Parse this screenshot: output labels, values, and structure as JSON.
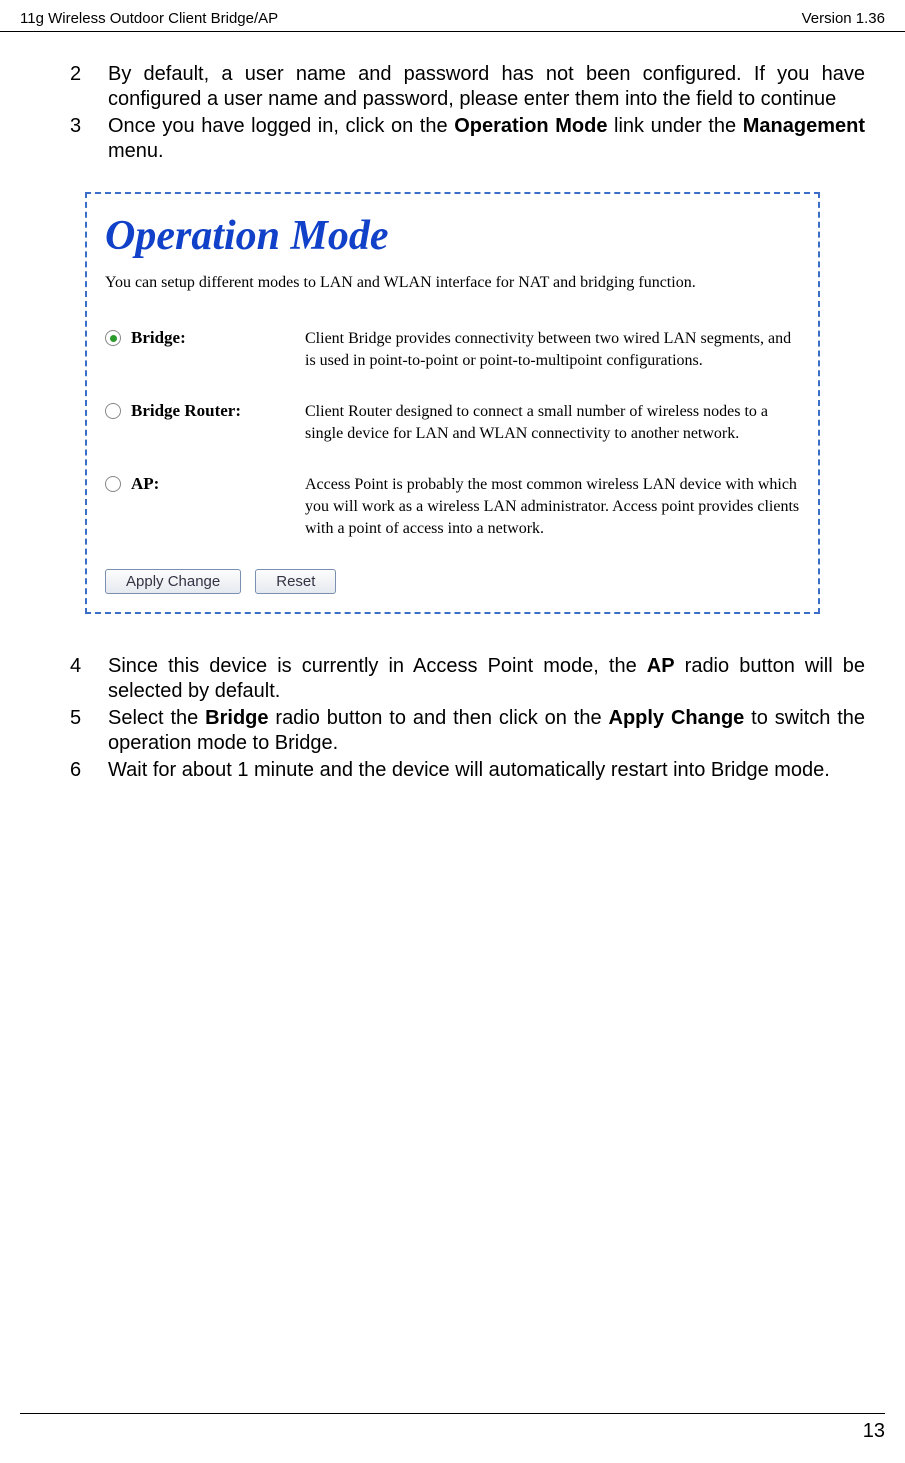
{
  "header": {
    "left": "11g Wireless Outdoor Client Bridge/AP",
    "right": "Version 1.36"
  },
  "steps_top": [
    {
      "num": "2",
      "html": "By default, a user name and password has not been configured. If you have configured a user name and password, please enter them into the field to continue"
    },
    {
      "num": "3",
      "html": "Once you have logged in, click on the <b>Operation Mode</b> link under the <b>Management</b> menu."
    }
  ],
  "panel": {
    "title": "Operation Mode",
    "desc": "You can setup different modes to LAN and WLAN interface for NAT and bridging function.",
    "modes": [
      {
        "selected": true,
        "label": "Bridge:",
        "text": "Client Bridge provides connectivity between two wired LAN segments, and is used in point-to-point or point-to-multipoint configurations."
      },
      {
        "selected": false,
        "label": "Bridge Router:",
        "text": "Client Router designed to connect a small number of wireless nodes to a single device for LAN and WLAN connectivity to another network."
      },
      {
        "selected": false,
        "label": "AP:",
        "text": "Access Point is probably the most common wireless LAN device with which you will work as a wireless LAN administrator. Access point provides clients with a point of access into a network."
      }
    ],
    "buttons": {
      "apply": "Apply Change",
      "reset": "Reset"
    }
  },
  "steps_bottom": [
    {
      "num": "4",
      "html": "Since this device is currently in Access Point mode, the <b>AP</b> radio button will be selected by default."
    },
    {
      "num": "5",
      "html": "Select the <b>Bridge</b> radio button to and then click on the <b>Apply Change</b> to switch the operation mode to Bridge."
    },
    {
      "num": "6",
      "html": "Wait for about 1 minute and the device will automatically restart into Bridge mode."
    }
  ],
  "footer": {
    "page": "13"
  }
}
